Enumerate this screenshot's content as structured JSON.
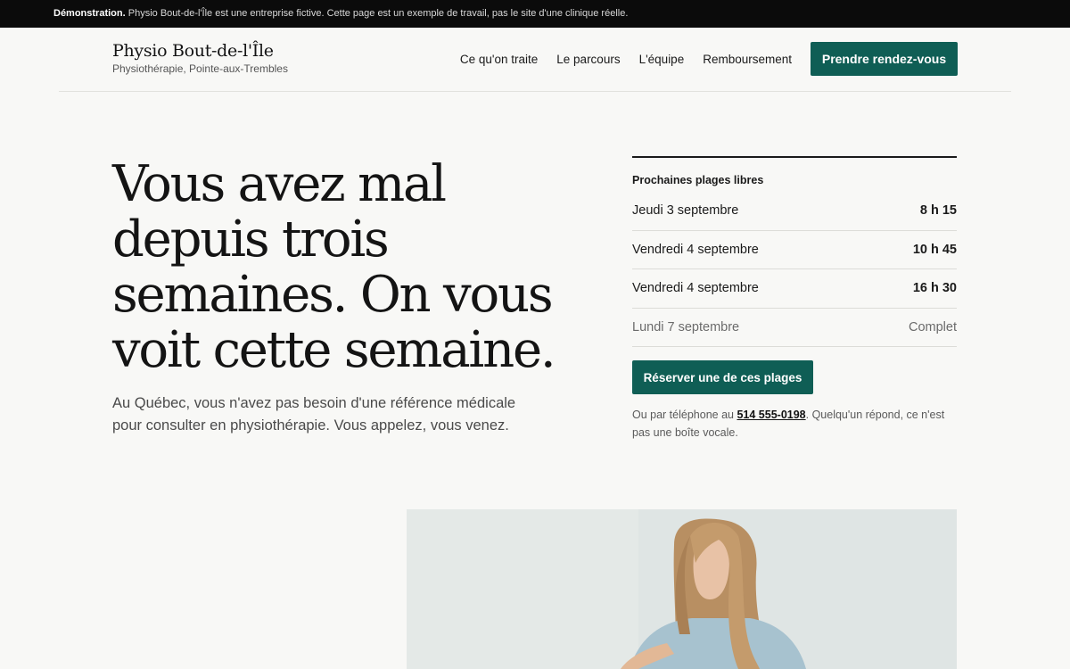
{
  "banner": {
    "strong": "Démonstration.",
    "text": "Physio Bout-de-l'Île est une entreprise fictive. Cette page est un exemple de travail, pas le site d'une clinique réelle."
  },
  "header": {
    "brand_name": "Physio Bout-de-l'Île",
    "brand_sub": "Physiothérapie, Pointe-aux-Trembles",
    "nav": [
      "Ce qu'on traite",
      "Le parcours",
      "L'équipe",
      "Remboursement"
    ],
    "cta_label": "Prendre rendez-vous"
  },
  "hero": {
    "title": "Vous avez mal depuis trois semaines. On vous voit cette semaine.",
    "lead": "Au Québec, vous n'avez pas besoin d'une référence médicale pour consulter en physiothérapie. Vous appelez, vous venez."
  },
  "slots": {
    "heading": "Prochaines plages libres",
    "rows": [
      {
        "day": "Jeudi 3 septembre",
        "time": "8 h 15"
      },
      {
        "day": "Vendredi 4 septembre",
        "time": "10 h 45"
      },
      {
        "day": "Vendredi 4 septembre",
        "time": "16 h 30"
      },
      {
        "day": "Lundi 7 septembre",
        "time": "Complet"
      }
    ],
    "button_label": "Réserver une de ces plages",
    "phone_prefix": "Ou par téléphone au",
    "phone_number": "514 555-0198",
    "phone_suffix": ". Quelqu'un répond, ce n'est pas une boîte vocale."
  },
  "colors": {
    "accent": "#0f5e55",
    "banner_bg": "#0b0b0b",
    "page_bg": "#f8f8f6"
  }
}
